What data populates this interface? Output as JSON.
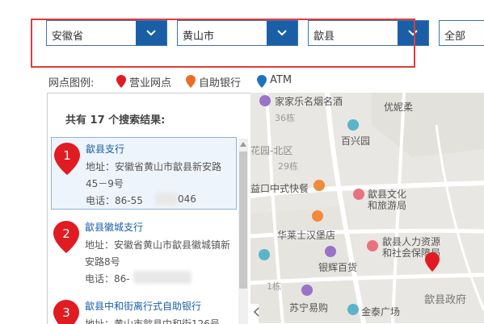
{
  "filters": {
    "province": "安徽省",
    "city": "黄山市",
    "county": "歙县",
    "type": "全部"
  },
  "legend": {
    "title": "网点图例:",
    "items": [
      {
        "label": "营业网点",
        "color": "#e11b22"
      },
      {
        "label": "自助银行",
        "color": "#f06b25"
      },
      {
        "label": "ATM",
        "color": "#1a72c0"
      }
    ]
  },
  "results": {
    "count_text": "共有 17 个搜索结果:",
    "items": [
      {
        "index": "1",
        "name": "歙县支行",
        "address_l1": "地址：安徽省黄山市歙县新安路",
        "address_l2": "45－9号",
        "phone": "电话：86-55",
        "phone_tail": "046"
      },
      {
        "index": "2",
        "name": "歙县徽城支行",
        "address_l1": "地址：安徽省黄山市歙县徽城镇新",
        "address_l2": "安路8号",
        "phone": "电话：86-"
      },
      {
        "index": "3",
        "name": "歙县中和街离行式自助银行",
        "address_l1": "地址：黄山市歙县中和街126号"
      }
    ]
  },
  "map": {
    "pois": [
      "家家乐名烟名酒",
      "优妮柔",
      "百兴园",
      "益口中式快餐",
      "歙县文化",
      "和旅游局",
      "华莱士汉堡店",
      "歙县人力资源",
      "和社会保障局",
      "银辉百货",
      "苏宁易购",
      "金泰广场",
      "歙县政府"
    ],
    "labels": [
      "36栋",
      "花园-北区",
      "29栋",
      "1栋"
    ]
  }
}
